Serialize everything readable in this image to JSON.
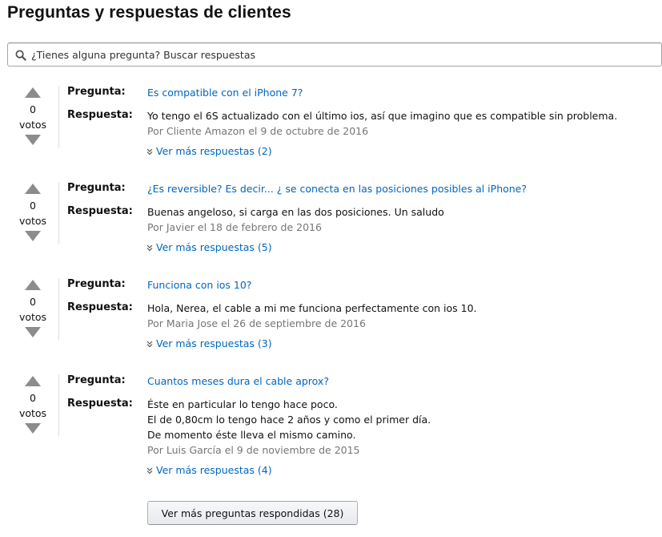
{
  "page_title": "Preguntas y respuestas de clientes",
  "search": {
    "placeholder": "¿Tienes alguna pregunta? Buscar respuestas",
    "icon": "search-icon"
  },
  "labels": {
    "question": "Pregunta:",
    "answer": "Respuesta:",
    "votes_label": "votos"
  },
  "items": [
    {
      "votes": "0",
      "question": "Es compatible con el iPhone 7?",
      "answer_lines": [
        "Yo tengo el 6S actualizado con el último ios, así que imagino que es compatible sin problema."
      ],
      "byline": "Por Cliente Amazon el 9 de octubre de 2016",
      "more_answers": "Ver más respuestas (2)"
    },
    {
      "votes": "0",
      "question": "¿Es reversible? Es decir... ¿ se conecta en las posiciones posibles al iPhone?",
      "answer_lines": [
        "Buenas angeloso, si carga en las dos posiciones. Un saludo"
      ],
      "byline": "Por Javier el 18 de febrero de 2016",
      "more_answers": "Ver más respuestas (5)"
    },
    {
      "votes": "0",
      "question": "Funciona con ios 10?",
      "answer_lines": [
        "Hola, Nerea, el cable a mi me funciona perfectamente con ios 10."
      ],
      "byline": "Por Maria Jose el 26 de septiembre de 2016",
      "more_answers": "Ver más respuestas (3)"
    },
    {
      "votes": "0",
      "question": "Cuantos meses dura el cable aprox?",
      "answer_lines": [
        "Éste en particular lo tengo hace poco.",
        "El de 0,80cm lo tengo hace 2 años y como el primer día.",
        "De momento éste lleva el mismo camino."
      ],
      "byline": "Por Luis García el 9 de noviembre de 2015",
      "more_answers": "Ver más respuestas (4)"
    }
  ],
  "more_questions_button": "Ver más preguntas respondidas (28)",
  "colors": {
    "link": "#0066c0",
    "byline": "#767676",
    "vote_arrow": "#8c8c8c",
    "text": "#111111"
  }
}
